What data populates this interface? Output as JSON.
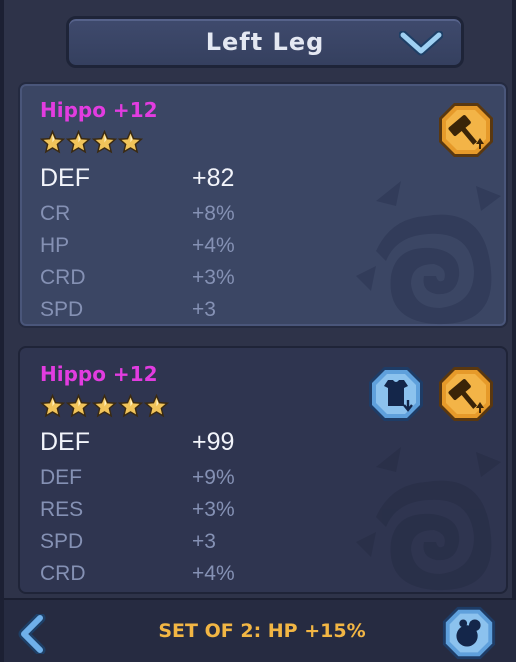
{
  "header": {
    "slot_label": "Left Leg"
  },
  "cards": [
    {
      "name": "Hippo +12",
      "stars": 4,
      "main_stat": {
        "name": "DEF",
        "value": "+82"
      },
      "sub_stats": [
        {
          "name": "CR",
          "value": "+8%"
        },
        {
          "name": "HP",
          "value": "+4%"
        },
        {
          "name": "CRD",
          "value": "+3%"
        },
        {
          "name": "SPD",
          "value": "+3"
        }
      ],
      "buttons": [
        "upgrade-hammer-icon"
      ]
    },
    {
      "name": "Hippo +12",
      "stars": 5,
      "main_stat": {
        "name": "DEF",
        "value": "+99"
      },
      "sub_stats": [
        {
          "name": "DEF",
          "value": "+9%"
        },
        {
          "name": "RES",
          "value": "+3%"
        },
        {
          "name": "SPD",
          "value": "+3"
        },
        {
          "name": "CRD",
          "value": "+4%"
        }
      ],
      "buttons": [
        "unequip-armor-icon",
        "upgrade-hammer-icon"
      ]
    }
  ],
  "footer": {
    "set_bonus": "SET OF 2:  HP +15%"
  },
  "colors": {
    "gear_name": "#e23ce0",
    "set_bonus": "#f2b644",
    "star": "#f1c45a",
    "orange_button": "#e69a2a",
    "blue_button": "#5fa0dc"
  }
}
